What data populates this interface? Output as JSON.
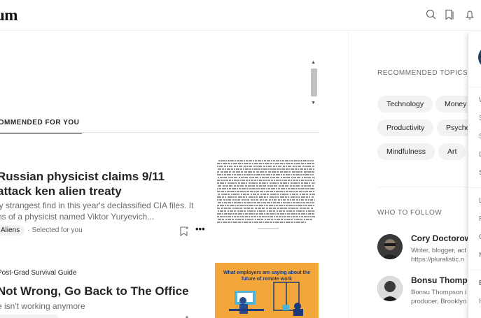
{
  "header": {
    "logo_text": "um",
    "icons": [
      "search-icon",
      "bookmarks-icon",
      "notifications-icon"
    ]
  },
  "feed": {
    "tab_label": "COMMENDED FOR YOU",
    "articles": [
      {
        "title": "Russian physicist claims 9/11 attack ken alien treaty",
        "subtitle": "ly strangest find in this year's declassified CIA files. It ns of a physicist named Viktor Yuryevich...",
        "topic": "Aliens",
        "note": "· Selected for you"
      },
      {
        "publication": "Post-Grad Survival Guide",
        "title": "Not Wrong, Go Back to The Office",
        "subtitle": "e isn't working anymore",
        "thumbnail_caption": "What employers are saying about the future of remote work"
      }
    ]
  },
  "sidebar": {
    "topics_heading": "RECOMMENDED TOPICS",
    "topics": [
      "Technology",
      "Money",
      "Productivity",
      "Psycho",
      "Mindfulness",
      "Art"
    ],
    "follow_heading": "WHO TO FOLLOW",
    "people": [
      {
        "name": "Cory Doctorow",
        "bio_line1": "Writer, blogger, act",
        "bio_line2": "https://pluralistic.n"
      },
      {
        "name": "Bonsu Thomps",
        "bio_line1": "Bonsu Thompson i",
        "bio_line2": "producer, Brooklyn"
      }
    ]
  },
  "menu": {
    "items": [
      "W",
      "S",
      "S",
      "D",
      "S",
      "L",
      "R",
      "C",
      "M",
      "B",
      "H"
    ]
  },
  "colors": {
    "text": "#242424",
    "muted": "#6b6b6b",
    "chip_bg": "#f2f2f2",
    "thumb2_bg": "#f3a63a"
  }
}
